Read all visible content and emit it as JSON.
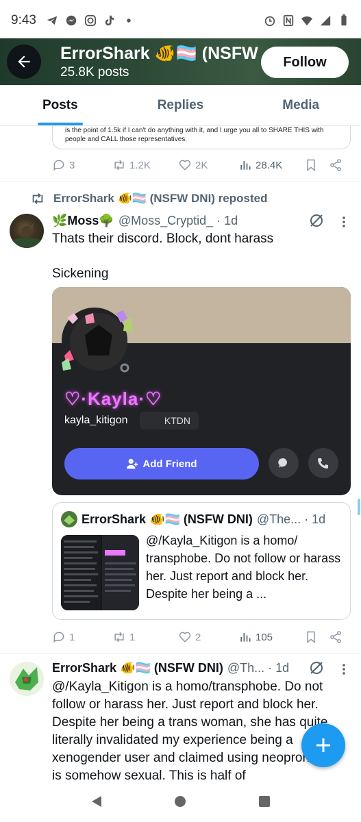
{
  "status_bar": {
    "time": "9:43"
  },
  "header": {
    "title": "ErrorShark 🐠🏳️‍⚧️ (NSFW ...",
    "subtitle": "25.8K posts",
    "follow_label": "Follow"
  },
  "tabs": [
    {
      "label": "Posts",
      "active": true
    },
    {
      "label": "Replies",
      "active": false
    },
    {
      "label": "Media",
      "active": false
    }
  ],
  "prev_post": {
    "card_text": "is the point of 1.5k if I can't do anything with it, and I urge you all to SHARE THIS with people and CALL those representatives.",
    "replies": "3",
    "reposts": "1.2K",
    "likes": "2K",
    "views": "28.4K"
  },
  "repost": {
    "label": "ErrorShark 🐠🏳️‍⚧️ (NSFW DNI) reposted",
    "author_name": "🌿Moss🌳",
    "author_handle": "@Moss_Cryptid_ · 1d",
    "text_line1": "Thats their discord. Block, dont harass",
    "text_line2": "Sickening",
    "discord": {
      "display_name": "♡·Kayla·♡",
      "username": "kayla_kitigon",
      "tag": "KTDN",
      "add_friend_label": "Add Friend"
    },
    "quote": {
      "author_name": "ErrorShark 🐠🏳️‍⚧️ (NSFW DNI)",
      "author_handle": "@The... · 1d",
      "text": "@/Kayla_Kitigon is a homo/ transphobe. Do not follow or harass her. Just report and block her. Despite her being a ..."
    },
    "replies": "1",
    "reposts": "1",
    "likes": "2",
    "views": "105"
  },
  "post3": {
    "author_name": "ErrorShark 🐠🏳️‍⚧️ (NSFW DNI)",
    "author_handle": "@Th... · 1d",
    "text": "@/Kayla_Kitigon is a homo/transphobe. Do not follow or harass her. Just report and block her. Despite her being a trans woman, she has quite literally invalidated my experience being a xenogender user and claimed using neopronouns is somehow sexual. This is half of"
  },
  "colors": {
    "accent": "#1d9bf0",
    "discord_blurple": "#5865f2",
    "kayla_pink": "#e879f9"
  }
}
